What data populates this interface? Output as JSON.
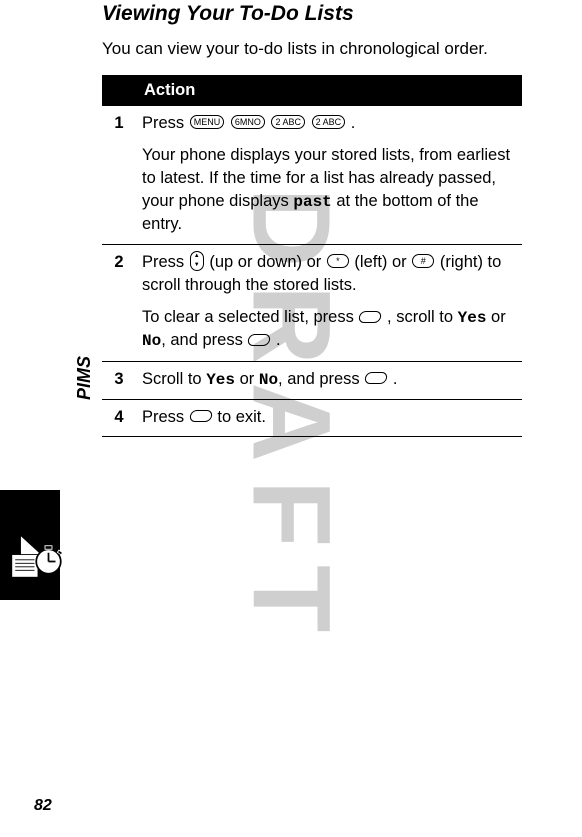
{
  "watermark": "DRAFT",
  "sidebar_label": "PIMS",
  "page_number": "82",
  "section_title": "Viewing Your To-Do Lists",
  "intro": "You can view your to-do lists in chronological order.",
  "action_header": "Action",
  "keys": {
    "menu": "MENU",
    "six": "6MNO",
    "two": "2 ABC",
    "star": "*",
    "hash": "#"
  },
  "steps": {
    "s1": {
      "num": "1",
      "p1a": "Press ",
      "p1b": ".",
      "p2a": "Your phone displays your stored lists, from earliest to latest. If the time for a list has already passed, your phone displays ",
      "p2code": "past",
      "p2b": " at the bottom of the entry."
    },
    "s2": {
      "num": "2",
      "p1a": "Press ",
      "p1b": " (up or down) or ",
      "p1c": " (left) or ",
      "p1d": " (right) to scroll through the stored lists.",
      "p2a": "To clear a selected list, press ",
      "p2b": ", scroll to ",
      "p2yes": "Yes",
      "p2c": " or ",
      "p2no": "No",
      "p2d": ", and press ",
      "p2e": "."
    },
    "s3": {
      "num": "3",
      "p1a": "Scroll to ",
      "yes": "Yes",
      "p1b": " or ",
      "no": "No",
      "p1c": ", and press ",
      "p1d": "."
    },
    "s4": {
      "num": "4",
      "p1a": "Press ",
      "p1b": " to exit."
    }
  }
}
